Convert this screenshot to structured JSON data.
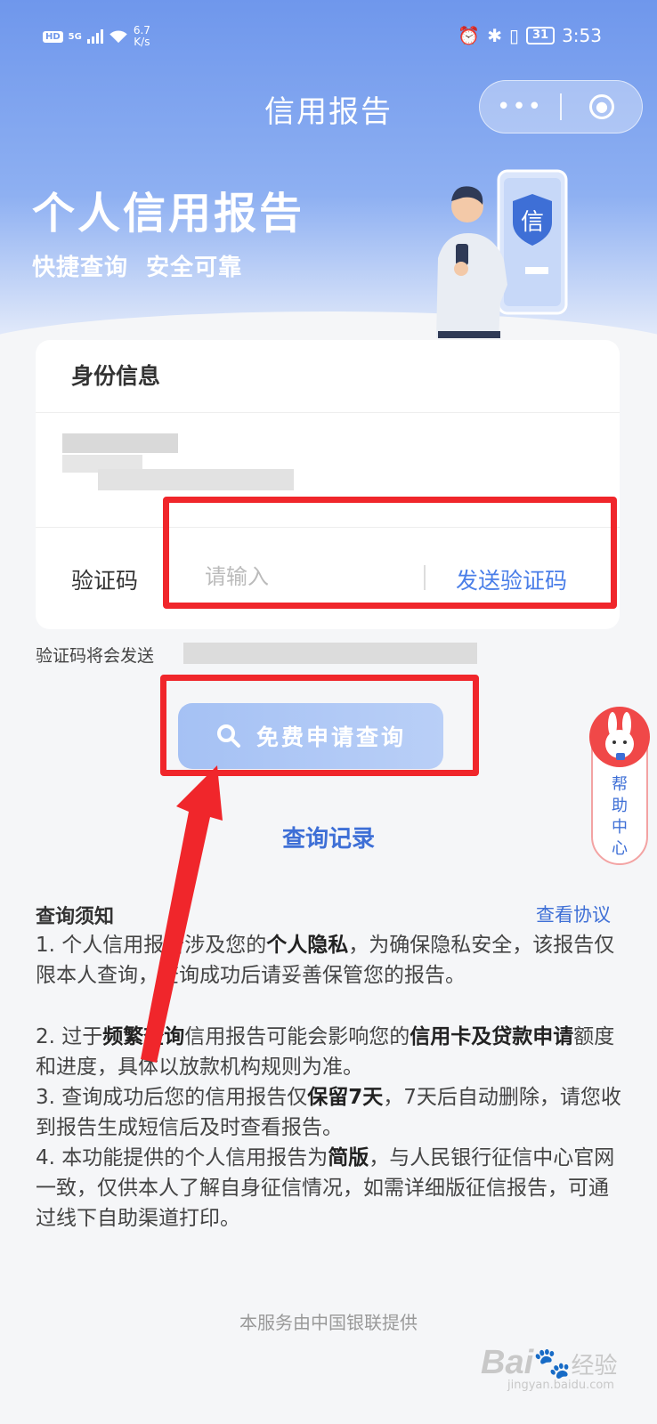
{
  "status_bar": {
    "network": "HD",
    "signal": "5G",
    "speed_value": "6.7",
    "speed_unit": "K/s",
    "battery": "31",
    "time": "3:53"
  },
  "nav": {
    "title": "信用报告",
    "more_icon": "more-dots-icon",
    "close_icon": "close-circle-icon"
  },
  "hero": {
    "title": "个人信用报告",
    "subtitle": "快捷查询  安全可靠",
    "badge_char": "信"
  },
  "identity": {
    "section_title": "身份信息"
  },
  "verification": {
    "label": "验证码",
    "placeholder": "请输入",
    "send_button": "发送验证码",
    "note_prefix": "验证码将会发送"
  },
  "actions": {
    "apply_button": "免费申请查询",
    "record_link": "查询记录"
  },
  "help": {
    "label": "帮助中心"
  },
  "notice": {
    "title": "查询须知",
    "agreement_link": "查看协议",
    "items": [
      {
        "p1": "1. 个人信用报告涉及您的",
        "b1": "个人隐私",
        "p2": "，为确保隐私安全，该报告仅限本人查询，查询成功后请妥善保管您的报告。"
      },
      {
        "p1": "2. 过于",
        "b1": "频繁查询",
        "p2": "信用报告可能会影响您的",
        "b2": "信用卡及贷款申请",
        "p3": "额度和进度，具体以放款机构规则为准。"
      },
      {
        "p1": "3. 查询成功后您的信用报告仅",
        "b1": "保留7天",
        "p2": "，7天后自动删除，请您收到报告生成短信后及时查看报告。"
      },
      {
        "p1": "4. 本功能提供的个人信用报告为",
        "b1": "简版",
        "p2": "，与人民银行征信中心官网一致，仅供本人了解自身征信情况，如需详细版征信报告，可通过线下自助渠道打印。"
      }
    ]
  },
  "footer": "本服务由中国银联提供",
  "watermark": {
    "brand": "Bai",
    "brand2": "经验",
    "url": "jingyan.baidu.com"
  },
  "colors": {
    "accent": "#4a7ee8",
    "annotation": "#f0262b",
    "hero": "#6f97ec"
  }
}
